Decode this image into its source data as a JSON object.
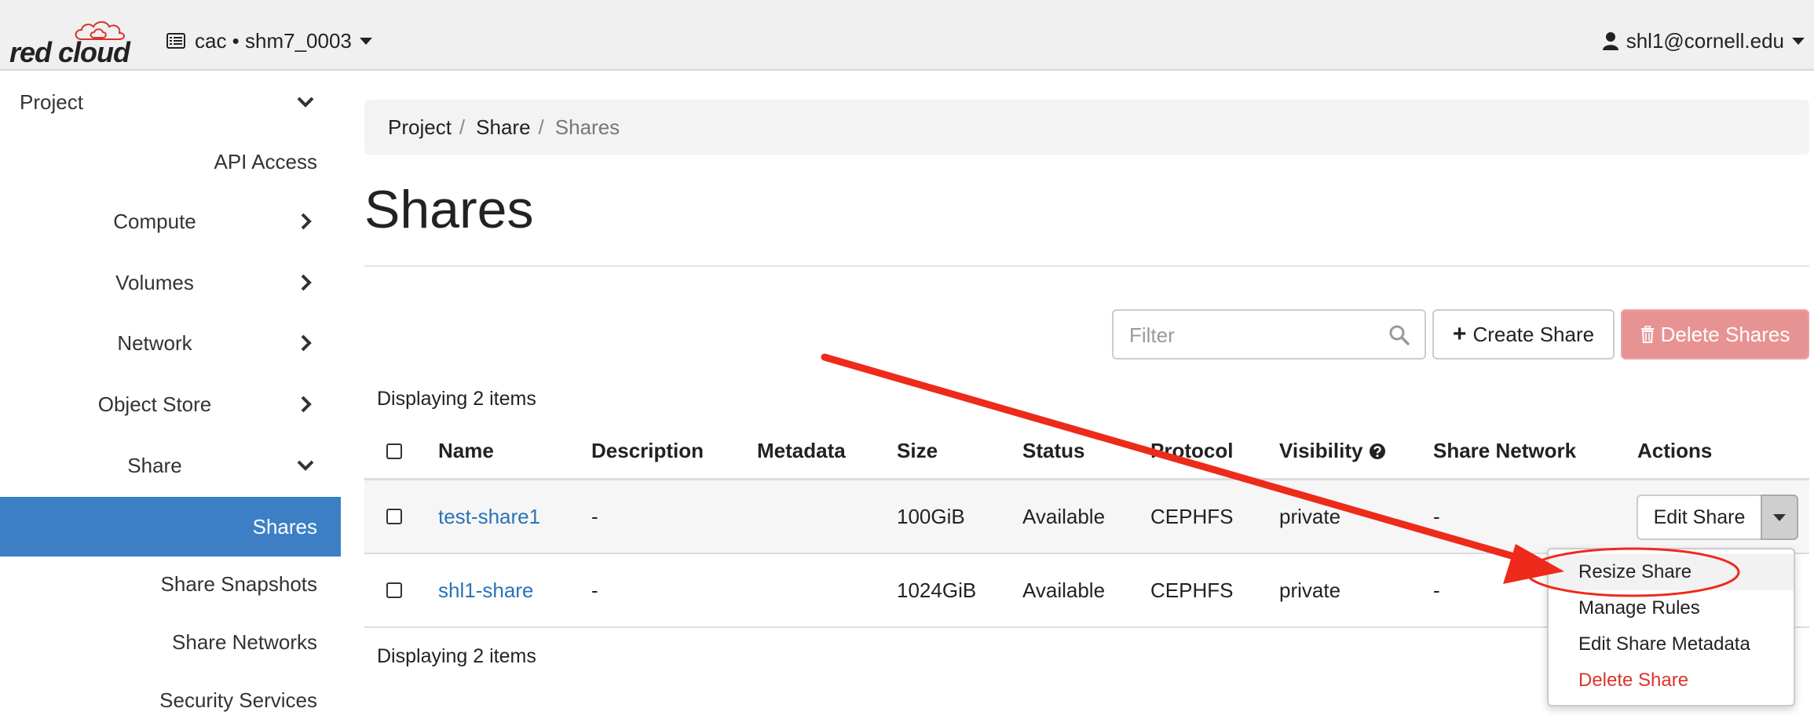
{
  "colors": {
    "sidebar_active": "#3d7fc5",
    "link": "#2a73b8",
    "delete_button": "#e89393",
    "danger_text": "#d9342b",
    "annotation": "#ee2a1b"
  },
  "navbar": {
    "logo_text": "red cloud",
    "project": "cac • shm7_0003",
    "user": "shl1@cornell.edu"
  },
  "sidebar": {
    "project": "Project",
    "items": [
      {
        "label": "API Access",
        "icon": "none"
      },
      {
        "label": "Compute",
        "icon": "chevron-right-icon"
      },
      {
        "label": "Volumes",
        "icon": "chevron-right-icon"
      },
      {
        "label": "Network",
        "icon": "chevron-right-icon"
      },
      {
        "label": "Object Store",
        "icon": "chevron-right-icon"
      },
      {
        "label": "Share",
        "icon": "chevron-down-icon"
      }
    ],
    "share_children": [
      {
        "label": "Shares",
        "active": true
      },
      {
        "label": "Share Snapshots"
      },
      {
        "label": "Share Networks"
      },
      {
        "label": "Security Services"
      }
    ]
  },
  "breadcrumb": [
    "Project",
    "Share",
    "Shares"
  ],
  "page_title": "Shares",
  "toolbar": {
    "filter_placeholder": "Filter",
    "create_label": "Create Share",
    "delete_label": "Delete Shares"
  },
  "table": {
    "count_label": "Displaying 2 items",
    "headers": [
      "Name",
      "Description",
      "Metadata",
      "Size",
      "Status",
      "Protocol",
      "Visibility",
      "Share Network",
      "Actions"
    ],
    "rows": [
      {
        "name": "test-share1",
        "description": "-",
        "metadata": "",
        "size": "100GiB",
        "status": "Available",
        "protocol": "CEPHFS",
        "visibility": "private",
        "share_network": "-"
      },
      {
        "name": "shl1-share",
        "description": "-",
        "metadata": "",
        "size": "1024GiB",
        "status": "Available",
        "protocol": "CEPHFS",
        "visibility": "private",
        "share_network": "-"
      }
    ],
    "row_action": "Edit Share"
  },
  "actions_menu": {
    "items": [
      "Resize Share",
      "Manage Rules",
      "Edit Share Metadata",
      "Delete Share"
    ]
  }
}
